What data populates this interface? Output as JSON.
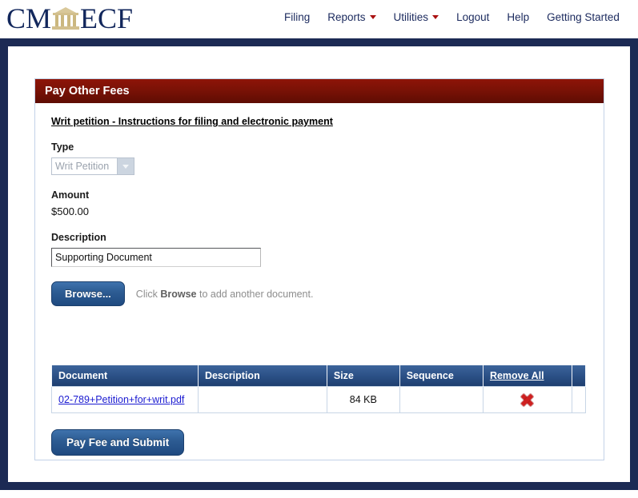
{
  "header": {
    "logo": {
      "prefix": "CM",
      "suffix": "ECF",
      "icon": "courthouse-icon"
    },
    "nav": [
      {
        "label": "Filing",
        "has_caret": false
      },
      {
        "label": "Reports",
        "has_caret": true
      },
      {
        "label": "Utilities",
        "has_caret": true
      },
      {
        "label": "Logout",
        "has_caret": false
      },
      {
        "label": "Help",
        "has_caret": false
      },
      {
        "label": "Getting Started",
        "has_caret": false
      }
    ]
  },
  "panel": {
    "title": "Pay Other Fees",
    "instructions_link": "Writ petition - Instructions for filing and electronic payment",
    "type": {
      "label": "Type",
      "value": "Writ Petition",
      "disabled": true
    },
    "amount": {
      "label": "Amount",
      "value": "$500.00"
    },
    "description": {
      "label": "Description",
      "value": "Supporting Document",
      "placeholder": ""
    },
    "browse": {
      "button_label": "Browse...",
      "hint_prefix": "Click ",
      "hint_bold": "Browse",
      "hint_suffix": " to add another document."
    },
    "table": {
      "headers": {
        "document": "Document",
        "description": "Description",
        "size": "Size",
        "sequence": "Sequence",
        "remove_all": "Remove All"
      },
      "rows": [
        {
          "document": "02-789+Petition+for+writ.pdf",
          "description": "",
          "size": "84 KB",
          "sequence": "",
          "remove_icon": "red-x-icon"
        }
      ]
    },
    "submit_label": "Pay Fee and Submit"
  },
  "colors": {
    "frame_navy": "#1c2a54",
    "title_red": "#7a1206",
    "button_blue": "#2d5c93",
    "link_blue": "#1b1bd1",
    "remove_red": "#cf2020",
    "logo_navy": "#12275c",
    "caret_red": "#aa1111"
  }
}
